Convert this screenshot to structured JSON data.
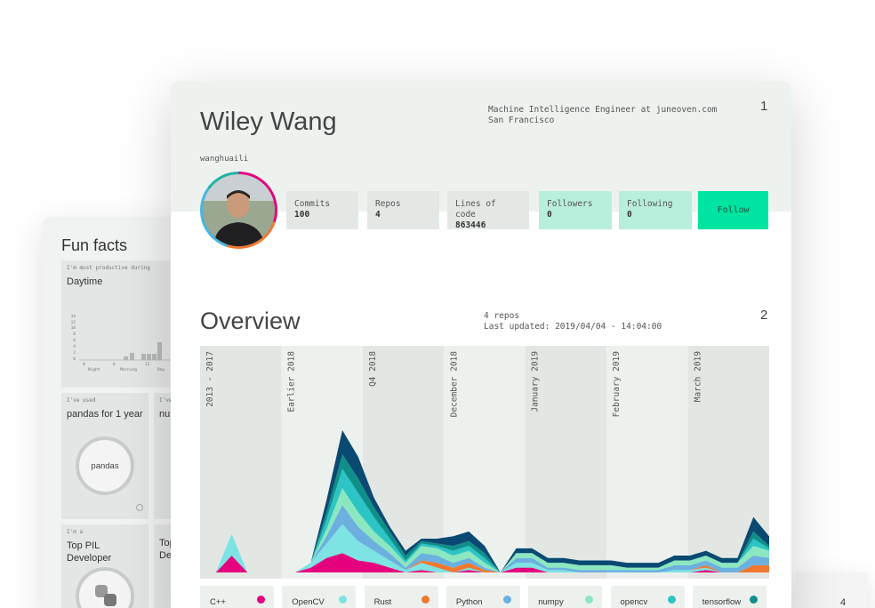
{
  "fun_facts": {
    "title": "Fun facts",
    "productive": {
      "small": "I'm most productive during",
      "big": "Daytime",
      "y_ticks": [
        "14",
        "12",
        "10",
        "8",
        "6",
        "4",
        "2",
        "0"
      ],
      "x_ticks": [
        "0",
        "6",
        "12"
      ],
      "x_labels": [
        "Night",
        "Morning",
        "Day"
      ]
    },
    "pandas": {
      "small": "I've used",
      "big": "pandas for 1 year",
      "circle": "pandas"
    },
    "tile_partial": {
      "small": "I've",
      "big": "nu"
    },
    "pil": {
      "small": "I'm a",
      "big1": "Top PIL",
      "big2": "Developer"
    },
    "tile_partial2": {
      "big1": "Top",
      "big2": "De"
    }
  },
  "profile": {
    "name": "Wiley Wang",
    "username": "wanghuaili",
    "job": "Machine Intelligence Engineer at juneoven.com",
    "location": "San Francisco",
    "section_number": "1",
    "stats": [
      {
        "label": "Commits",
        "value": "100"
      },
      {
        "label": "Repos",
        "value": "4"
      },
      {
        "label": "Lines of code",
        "value": "863446"
      },
      {
        "label": "Followers",
        "value": "0"
      },
      {
        "label": "Following",
        "value": "0"
      }
    ],
    "follow_label": "Follow"
  },
  "overview": {
    "title": "Overview",
    "repos": "4 repos",
    "updated": "Last updated: 2019/04/04 - 14:04:00",
    "section_number": "2"
  },
  "card4": {
    "number": "4"
  },
  "colors": {
    "cpp": "#e5007e",
    "opencv": "#7de3e3",
    "rust": "#f07830",
    "python": "#6cb0e0",
    "numpy": "#8be7c0",
    "opencv2": "#2cc4c4",
    "tensorflow": "#0f8f8a",
    "navy": "#0a4a72",
    "follow": "#00e4a1"
  },
  "chart_data": {
    "type": "area",
    "periods": [
      "2013 - 2017",
      "Earlier 2018",
      "Q4 2018",
      "December 2018",
      "January 2019",
      "February 2019",
      "March 2019"
    ],
    "series": [
      {
        "name": "C++",
        "color": "#e5007e",
        "values": [
          0,
          0,
          7,
          0,
          0,
          0,
          0,
          2,
          6,
          8,
          5,
          4,
          2,
          0,
          1,
          0,
          0,
          1,
          0,
          0,
          2,
          2,
          0,
          0,
          0,
          0,
          0,
          0,
          0,
          0,
          0,
          0,
          1,
          0,
          0,
          0,
          0
        ]
      },
      {
        "name": "OpenCV",
        "color": "#7de3e3",
        "values": [
          0,
          0,
          9,
          0,
          0,
          0,
          0,
          2,
          6,
          12,
          8,
          5,
          3,
          1,
          3,
          2,
          0,
          1,
          0,
          0,
          2,
          2,
          1,
          1,
          0,
          0,
          0,
          0,
          0,
          0,
          1,
          1,
          1,
          0,
          0,
          0,
          0
        ]
      },
      {
        "name": "Rust",
        "color": "#f07830",
        "values": [
          0,
          0,
          0,
          0,
          0,
          0,
          0,
          0,
          0,
          0,
          0,
          0,
          0,
          0,
          1,
          2,
          2,
          2,
          1,
          0,
          0,
          0,
          0,
          0,
          0,
          0,
          0,
          0,
          0,
          0,
          0,
          0,
          1,
          0,
          0,
          3,
          3
        ]
      },
      {
        "name": "Python",
        "color": "#6cb0e0",
        "values": [
          0,
          0,
          0,
          0,
          0,
          0,
          0,
          0,
          3,
          8,
          6,
          4,
          3,
          1,
          3,
          3,
          2,
          2,
          1,
          0,
          2,
          2,
          1,
          1,
          1,
          1,
          1,
          1,
          1,
          1,
          2,
          2,
          2,
          2,
          2,
          4,
          3
        ]
      },
      {
        "name": "numpy",
        "color": "#8be7c0",
        "values": [
          0,
          0,
          0,
          0,
          0,
          0,
          0,
          0,
          3,
          7,
          6,
          4,
          3,
          2,
          3,
          3,
          3,
          3,
          2,
          0,
          2,
          2,
          2,
          2,
          2,
          2,
          2,
          1,
          1,
          1,
          2,
          2,
          2,
          2,
          2,
          4,
          3
        ]
      },
      {
        "name": "opencv",
        "color": "#2cc4c4",
        "values": [
          0,
          0,
          0,
          0,
          0,
          0,
          0,
          0,
          4,
          8,
          8,
          6,
          3,
          1,
          1,
          1,
          2,
          2,
          2,
          0,
          0,
          0,
          0,
          0,
          0,
          0,
          0,
          0,
          0,
          0,
          0,
          0,
          0,
          0,
          0,
          3,
          1
        ]
      },
      {
        "name": "tensorflow",
        "color": "#0f8f8a",
        "values": [
          0,
          0,
          0,
          0,
          0,
          0,
          0,
          0,
          3,
          6,
          6,
          4,
          3,
          2,
          1,
          1,
          2,
          2,
          2,
          0,
          0,
          0,
          0,
          0,
          0,
          0,
          0,
          0,
          0,
          0,
          0,
          0,
          0,
          0,
          0,
          3,
          1
        ]
      },
      {
        "name": "",
        "color": "#0a4a72",
        "values": [
          0,
          0,
          0,
          0,
          0,
          0,
          0,
          0,
          5,
          10,
          9,
          4,
          2,
          2,
          1,
          2,
          4,
          4,
          3,
          0,
          2,
          2,
          2,
          2,
          2,
          2,
          2,
          2,
          2,
          2,
          2,
          2,
          2,
          2,
          2,
          6,
          4
        ]
      }
    ]
  }
}
